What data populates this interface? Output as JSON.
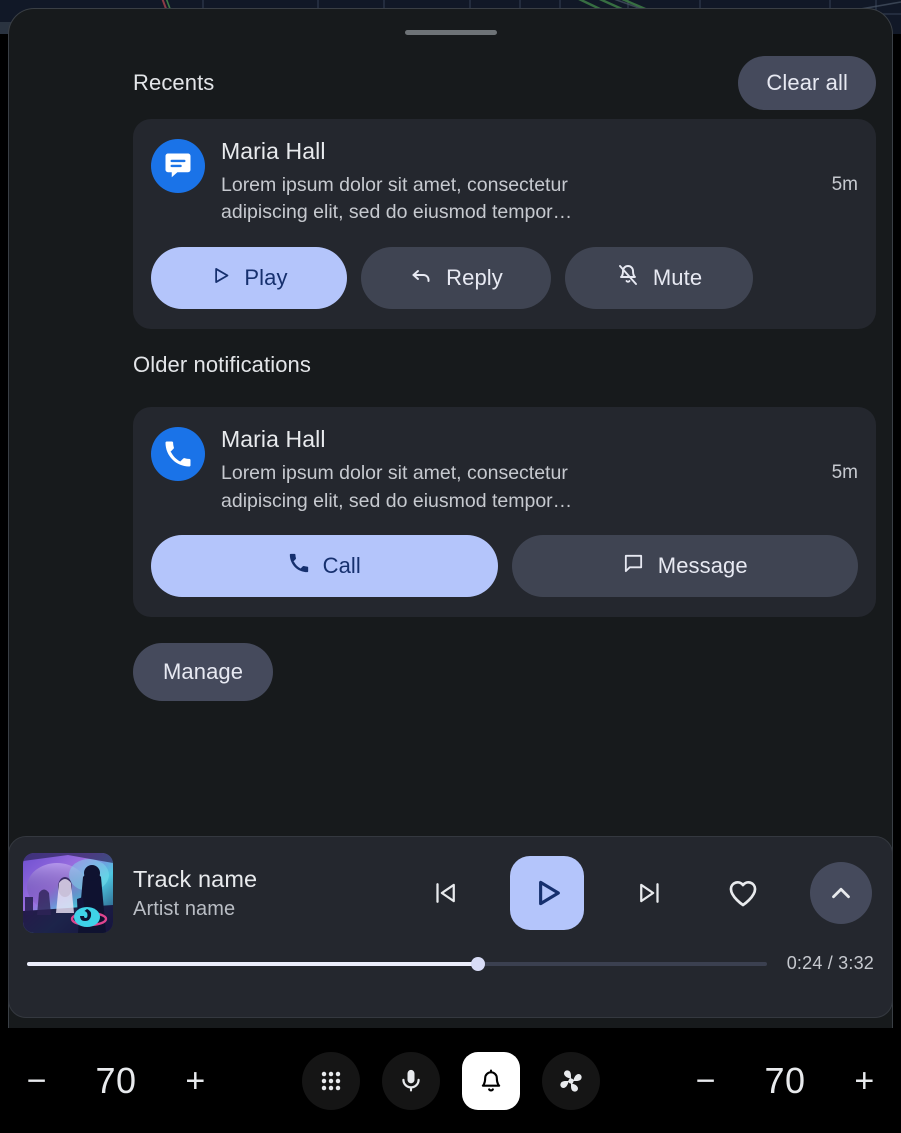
{
  "panel": {
    "drag_handle": "drag-handle"
  },
  "recents": {
    "title": "Recents",
    "clear_all_label": "Clear all",
    "notification": {
      "icon": "message-icon",
      "sender": "Maria Hall",
      "text": "Lorem ipsum dolor sit amet, consectetur adipiscing elit, sed do eiusmod tempor…",
      "time": "5m",
      "actions": [
        {
          "label": "Play",
          "icon": "play-icon",
          "style": "primary"
        },
        {
          "label": "Reply",
          "icon": "reply-icon",
          "style": "secondary"
        },
        {
          "label": "Mute",
          "icon": "bell-off-icon",
          "style": "secondary"
        }
      ]
    }
  },
  "older": {
    "title": "Older notifications",
    "notification": {
      "icon": "phone-icon",
      "sender": "Maria Hall",
      "text": "Lorem ipsum dolor sit amet, consectetur adipiscing elit, sed do eiusmod tempor…",
      "time": "5m",
      "actions": [
        {
          "label": "Call",
          "icon": "phone-icon",
          "style": "primary"
        },
        {
          "label": "Message",
          "icon": "chat-bubble-icon",
          "style": "secondary"
        }
      ]
    },
    "manage_label": "Manage"
  },
  "media": {
    "album_art": "concert-photo",
    "track_name": "Track name",
    "artist_name": "Artist name",
    "controls": {
      "previous": "skip-previous-icon",
      "play": "play-icon",
      "next": "skip-next-icon",
      "favorite": "heart-icon",
      "expand": "chevron-up-icon"
    },
    "progress": {
      "elapsed": "0:24",
      "duration": "3:32",
      "time_display": "0:24 / 3:32",
      "percent": 61
    }
  },
  "navbar": {
    "volume_left": {
      "minus": "−",
      "value": "70",
      "plus": "+"
    },
    "volume_right": {
      "minus": "−",
      "value": "70",
      "plus": "+"
    },
    "buttons": [
      {
        "name": "apps-grid-icon",
        "active": false
      },
      {
        "name": "microphone-icon",
        "active": false
      },
      {
        "name": "notifications-bell-icon",
        "active": true
      },
      {
        "name": "climate-fan-icon",
        "active": false
      }
    ]
  },
  "colors": {
    "accent_lavender": "#B4C5FB",
    "accent_text_navy": "#16306E",
    "panel_bg": "#171A1C",
    "card_bg": "#24272E",
    "chip_bg": "#454A5C",
    "avatar_blue": "#1A73E8"
  }
}
